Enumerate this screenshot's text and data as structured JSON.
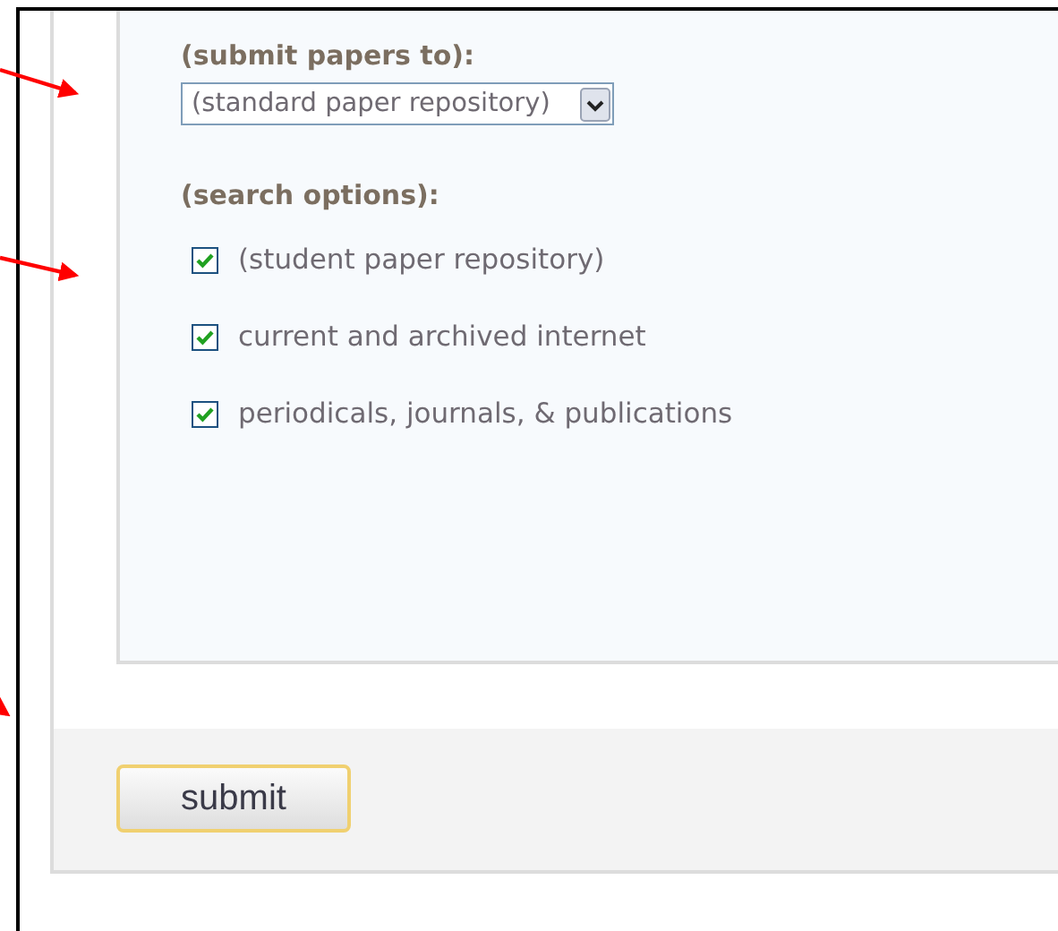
{
  "submit_to": {
    "label": "(submit papers to):",
    "dropdown_value": "(standard paper repository)"
  },
  "search_options": {
    "label": "(search options):",
    "options": [
      {
        "label": "(student paper repository)",
        "checked": true
      },
      {
        "label": "current and archived internet",
        "checked": true
      },
      {
        "label": "periodicals, journals, & publications",
        "checked": true
      }
    ]
  },
  "buttons": [
    "submit"
  ],
  "annotations": [
    {
      "kind": "arrow"
    },
    {
      "kind": "arrow"
    },
    {
      "kind": "arrow"
    }
  ]
}
